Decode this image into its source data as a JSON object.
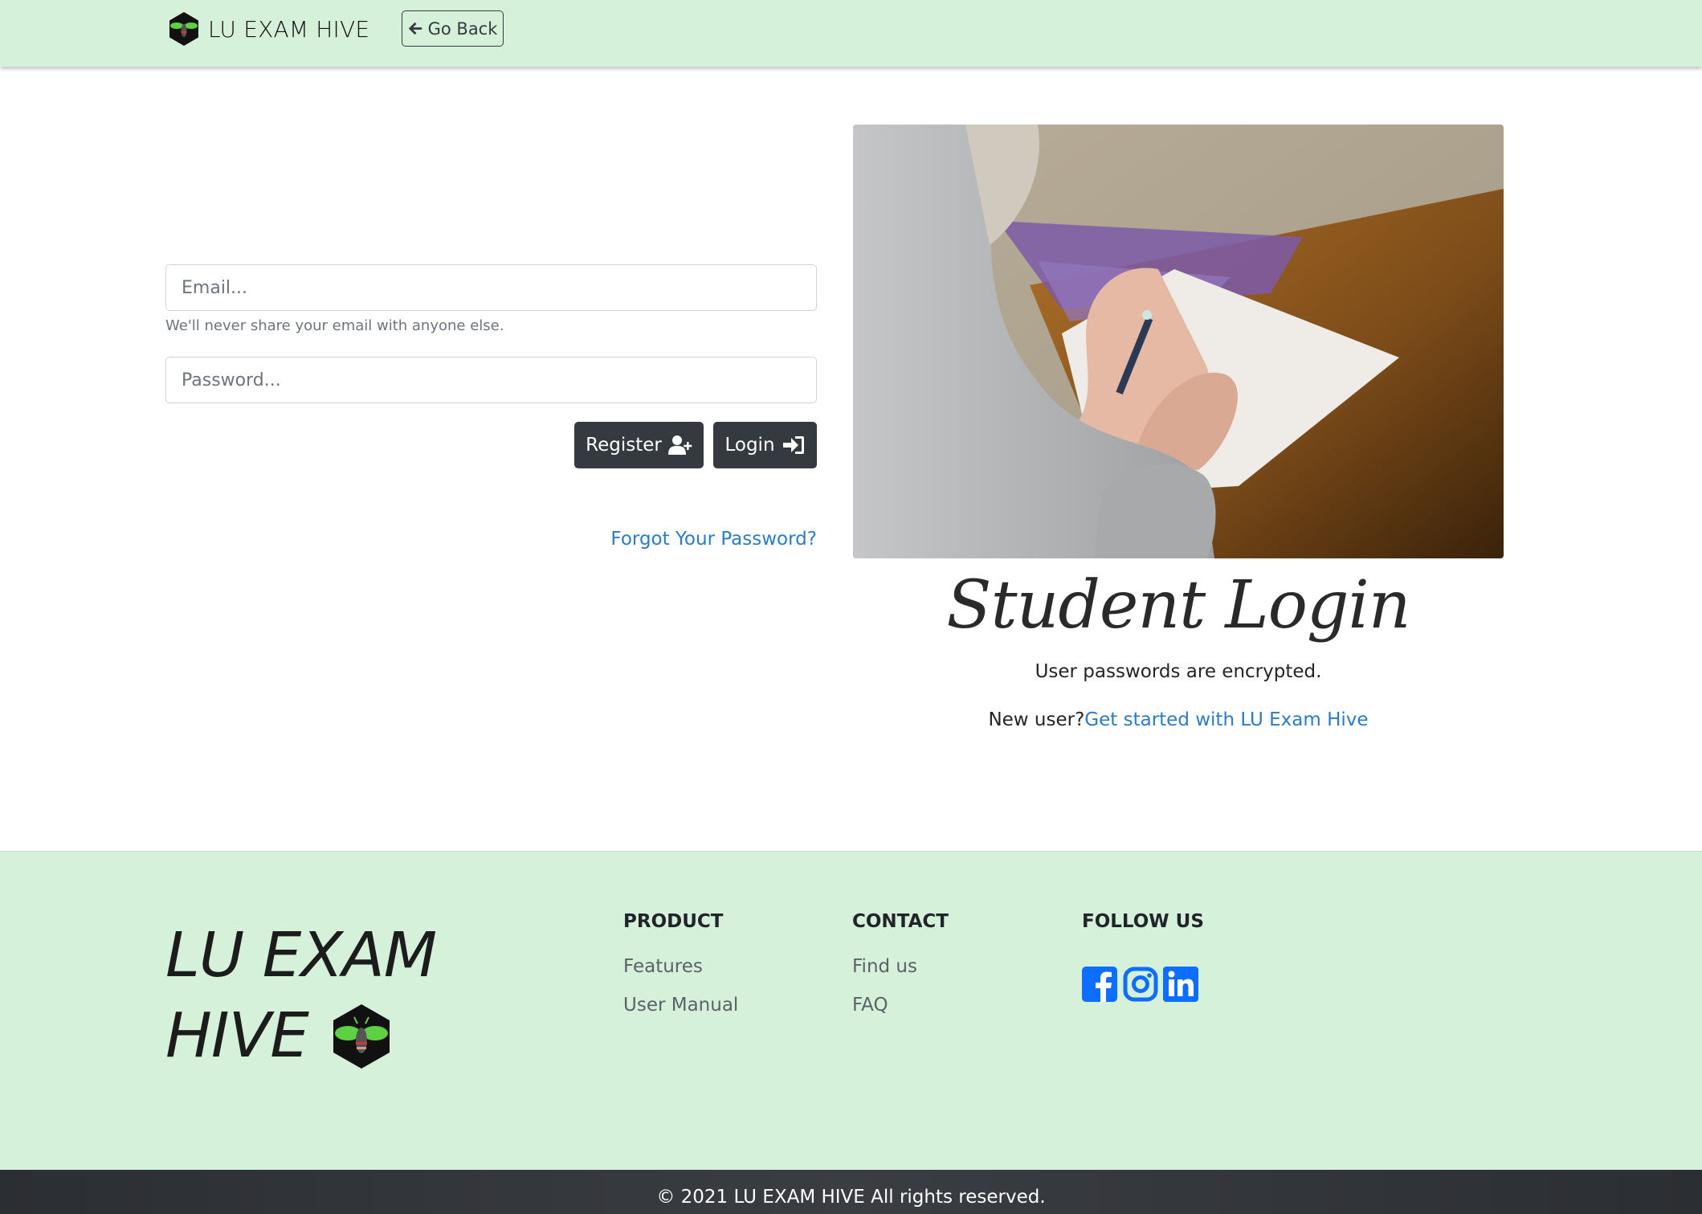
{
  "nav": {
    "brand": "LU EXAM HIVE",
    "go_back_label": "Go Back"
  },
  "form": {
    "email_placeholder": "Email...",
    "email_help": "We'll never share your email with anyone else.",
    "password_placeholder": "Password...",
    "register_label": "Register",
    "login_label": "Login",
    "forgot_link": "Forgot Your Password?"
  },
  "hero": {
    "title": "Student Login",
    "encryption_note": "User passwords are encrypted.",
    "new_user_text": "New user?",
    "get_started_link": "Get started with LU Exam Hive"
  },
  "footer": {
    "brand_line1": "LU EXAM",
    "brand_line2": "HIVE",
    "product": {
      "heading": "PRODUCT",
      "links": [
        "Features",
        "User Manual"
      ]
    },
    "contact": {
      "heading": "CONTACT",
      "links": [
        "Find us",
        "FAQ"
      ]
    },
    "follow": {
      "heading": "FOLLOW US",
      "icons": [
        "facebook-icon",
        "instagram-icon",
        "linkedin-icon"
      ]
    },
    "copyright": "© 2021 LU EXAM HIVE All rights reserved."
  },
  "colors": {
    "nav_bg": "#d6f1da",
    "footer_bg": "#d6f1da",
    "dark_button": "#343a40",
    "link": "#2a7bc8",
    "social": "#0d6efd",
    "bee_green": "#5ed142"
  }
}
